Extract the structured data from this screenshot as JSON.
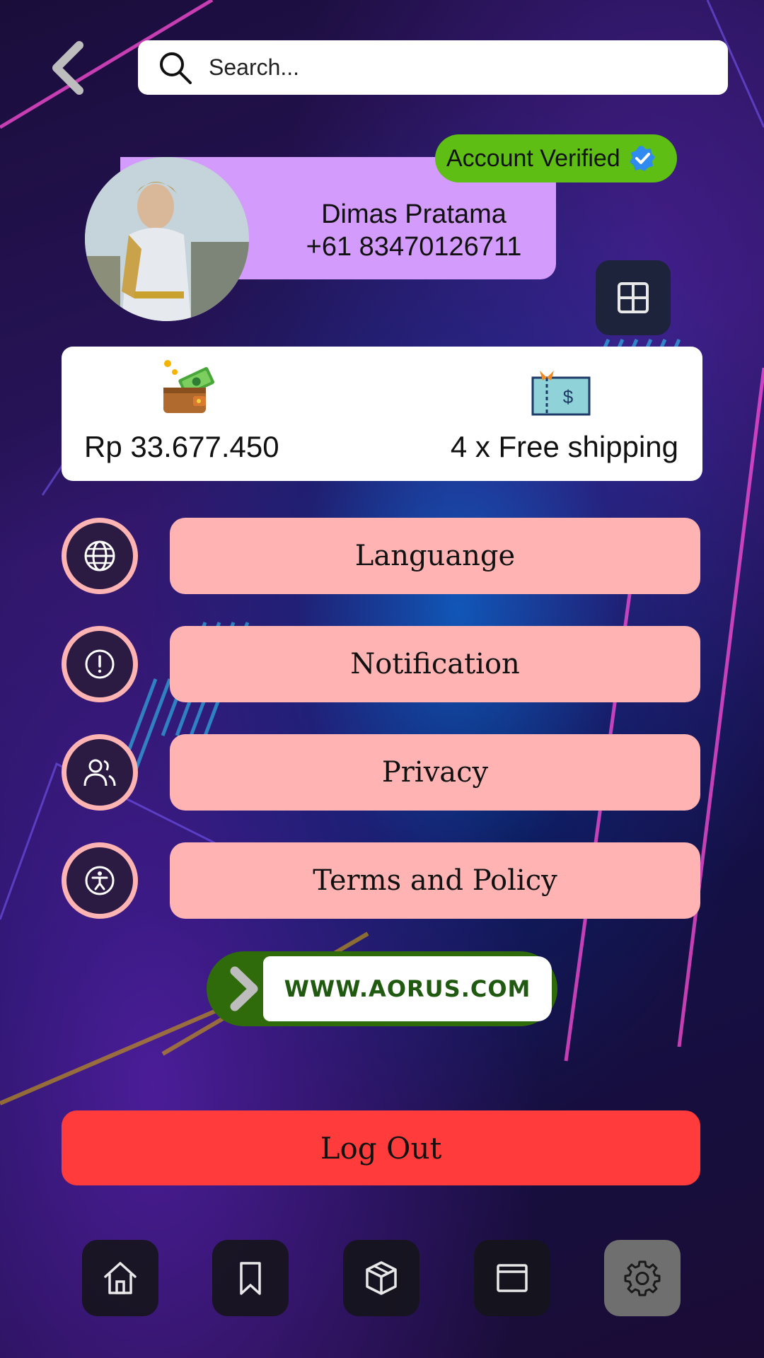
{
  "header": {
    "search": {
      "placeholder": "Search...",
      "value": ""
    }
  },
  "profile": {
    "verified_label": "Account Verified",
    "name": "Dimas Pratama",
    "phone": "+61 83470126711"
  },
  "balance": {
    "amount": "Rp 33.677.450",
    "shipping": "4 x Free shipping"
  },
  "menu": {
    "items": [
      {
        "label": "Languange",
        "icon": "globe-icon"
      },
      {
        "label": "Notification",
        "icon": "alert-icon"
      },
      {
        "label": "Privacy",
        "icon": "users-icon"
      },
      {
        "label": "Terms and Policy",
        "icon": "accessibility-icon"
      }
    ]
  },
  "website": {
    "label": "WWW.AORUS.COM"
  },
  "logout": {
    "label": "Log Out"
  },
  "bottom_nav": {
    "items": [
      {
        "icon": "home-icon",
        "active": false
      },
      {
        "icon": "bookmark-icon",
        "active": false
      },
      {
        "icon": "box-icon",
        "active": false
      },
      {
        "icon": "window-icon",
        "active": false
      },
      {
        "icon": "settings-icon",
        "active": true
      }
    ]
  },
  "colors": {
    "verified": "#5fbe14",
    "profile_card": "#d39bfb",
    "menu_button": "#ffb3b3",
    "logout": "#ff3b3b",
    "website_green": "#2f6b0a"
  }
}
